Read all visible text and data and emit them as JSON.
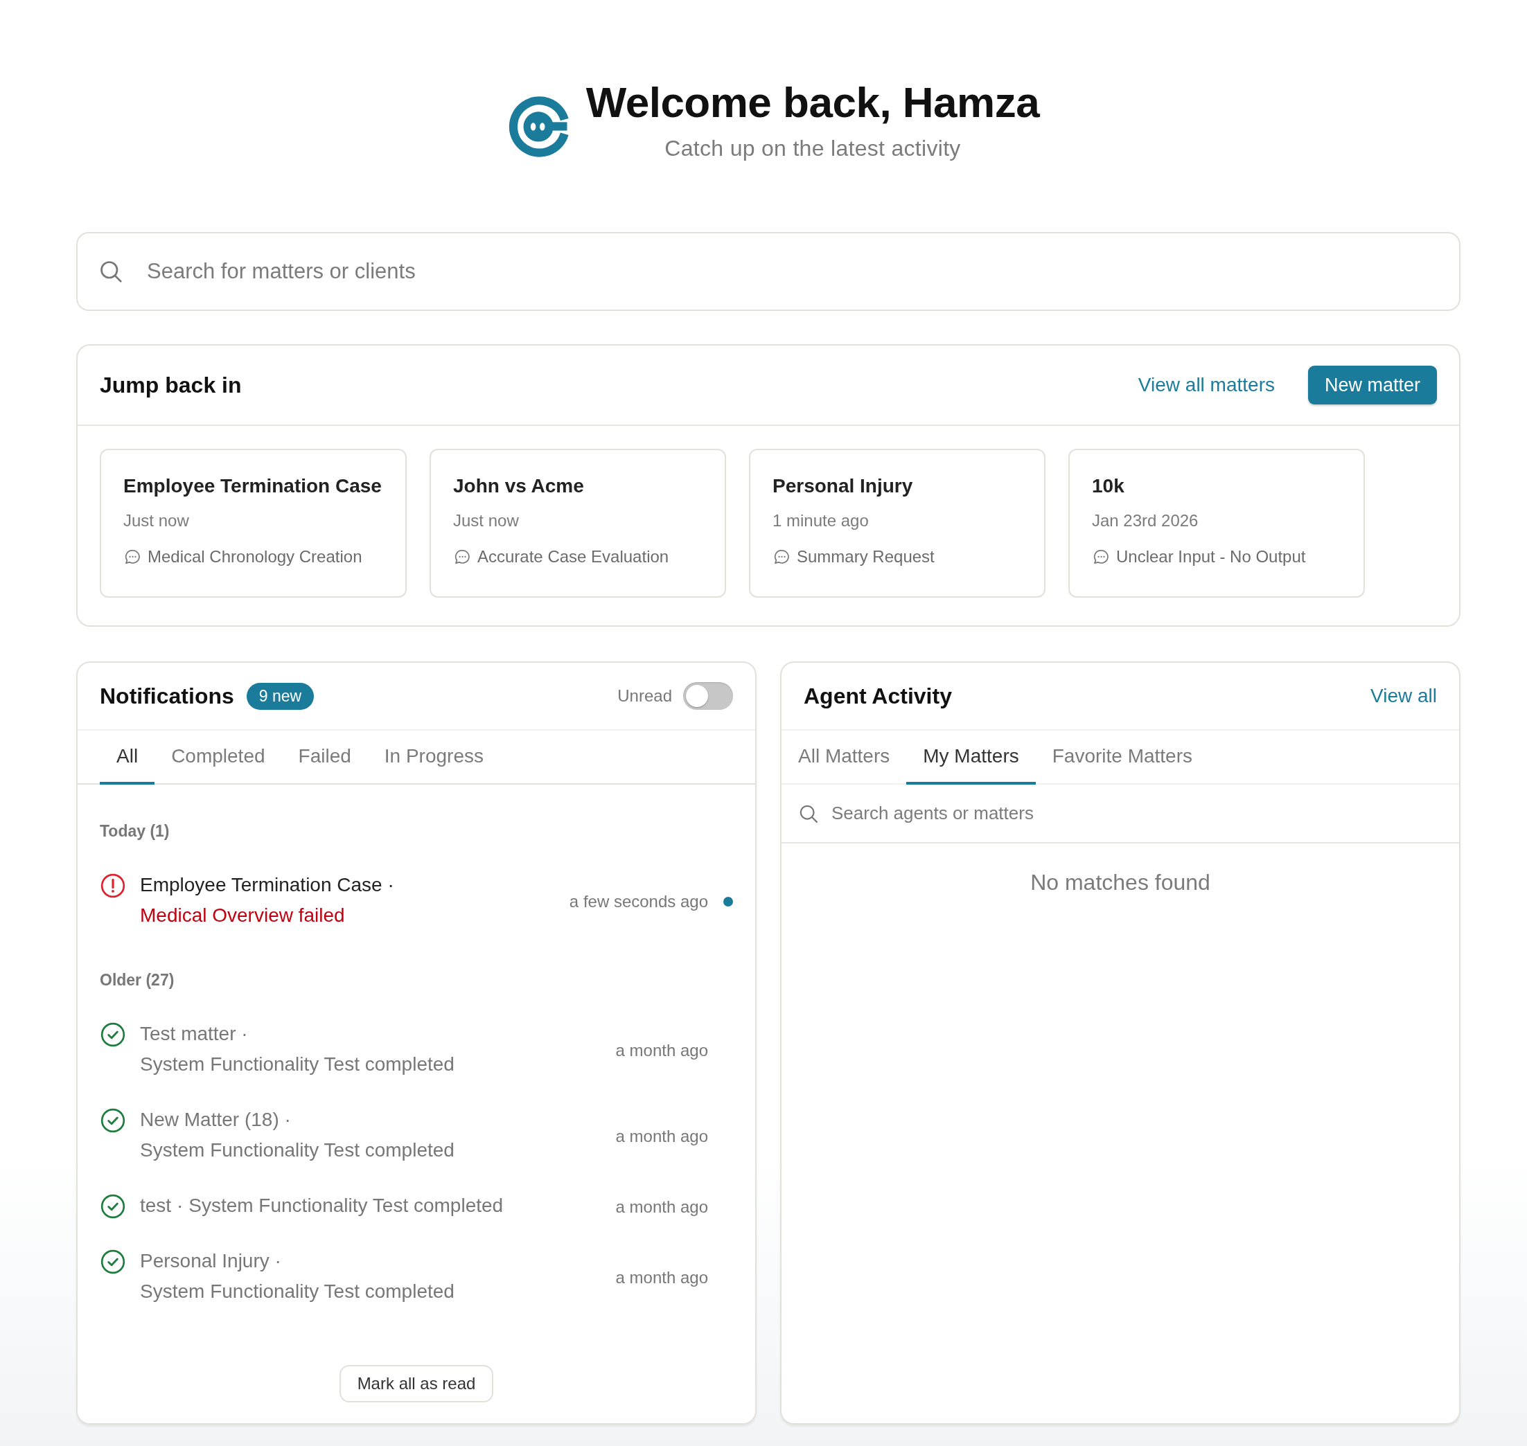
{
  "header": {
    "title": "Welcome back, Hamza",
    "subtitle": "Catch up on the latest activity"
  },
  "search": {
    "placeholder": "Search for matters or clients"
  },
  "jump_back_in": {
    "title": "Jump back in",
    "link": "View all matters",
    "button": "New matter",
    "cards": [
      {
        "title": "Employee Termination Case",
        "time": "Just now",
        "activity": "Medical Chronology Creation"
      },
      {
        "title": "John vs Acme",
        "time": "Just now",
        "activity": "Accurate Case Evaluation"
      },
      {
        "title": "Personal Injury",
        "time": "1 minute ago",
        "activity": "Summary Request"
      },
      {
        "title": "10k",
        "time": "Jan 23rd 2026",
        "activity": "Unclear Input - No Output"
      }
    ]
  },
  "notifications": {
    "title": "Notifications",
    "badge": "9 new",
    "toggle": {
      "label": "Unread",
      "on": false
    },
    "tabs": [
      {
        "label": "All",
        "selected": true
      },
      {
        "label": "Completed",
        "selected": false
      },
      {
        "label": "Failed",
        "selected": false
      },
      {
        "label": "In Progress",
        "selected": false
      }
    ],
    "groups": [
      {
        "label": "Today (1)",
        "items": [
          {
            "kind": "failed",
            "title": "Employee Termination Case ·",
            "detail": "Medical Overview failed",
            "time": "a few seconds ago",
            "unread": true
          }
        ]
      },
      {
        "label": "Older (27)",
        "items": [
          {
            "kind": "completed",
            "title": "Test matter ·",
            "detail": "System Functionality Test completed",
            "time": "a month ago",
            "unread": false
          },
          {
            "kind": "completed",
            "title": "New Matter (18) ·",
            "detail": "System Functionality Test completed",
            "time": "a month ago",
            "unread": false
          },
          {
            "kind": "completed",
            "title": "test ·",
            "detail": "System Functionality Test completed",
            "time": "a month ago",
            "unread": false
          },
          {
            "kind": "completed",
            "title": "Personal Injury ·",
            "detail": "System Functionality Test completed",
            "time": "a month ago",
            "unread": false
          }
        ]
      }
    ],
    "mark_all_button": "Mark all as read"
  },
  "agent_activity": {
    "title": "Agent Activity",
    "link": "View all",
    "tabs": [
      {
        "label": "All Matters",
        "selected": false
      },
      {
        "label": "My Matters",
        "selected": true
      },
      {
        "label": "Favorite Matters",
        "selected": false
      }
    ],
    "search": {
      "placeholder": "Search agents or matters"
    },
    "empty_message": "No matches found"
  }
}
